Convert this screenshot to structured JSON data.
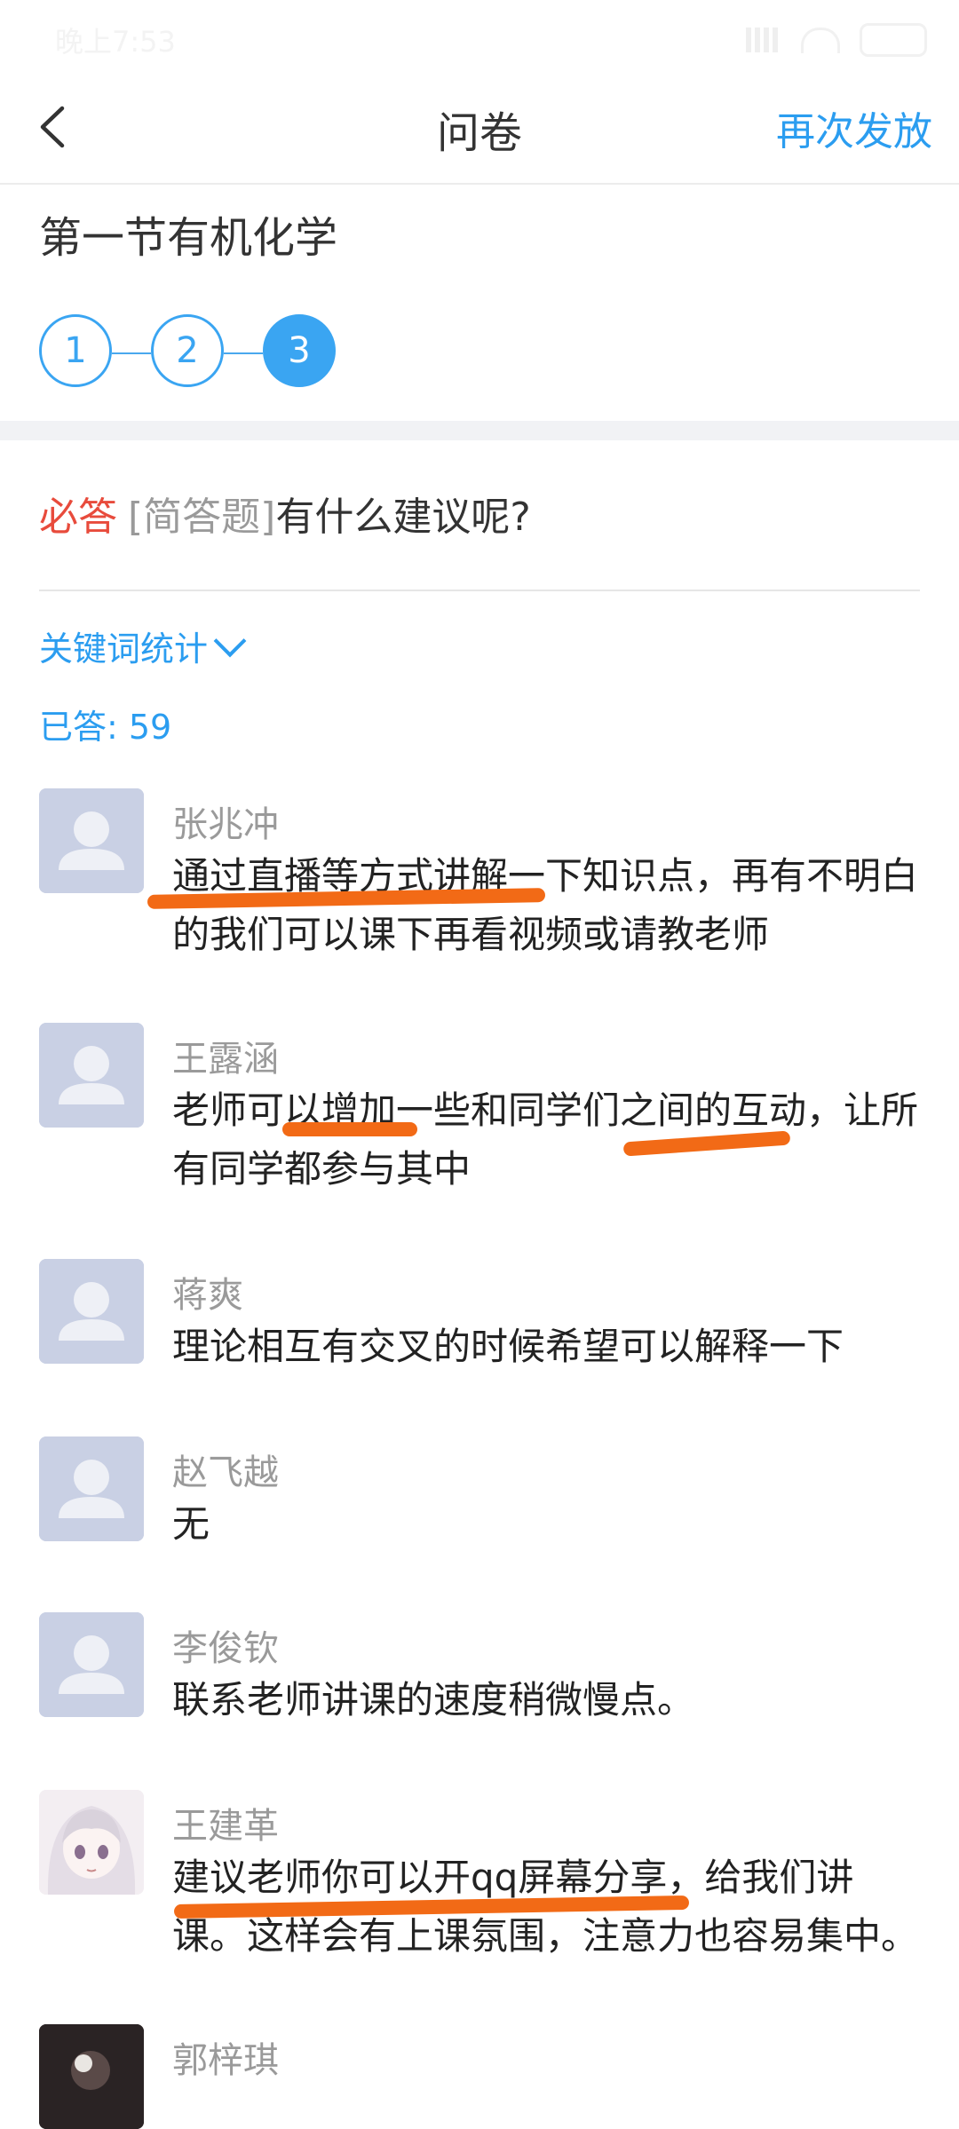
{
  "status_bar": {
    "time": "晚上7:53"
  },
  "nav": {
    "back_icon": "chevron-left-icon",
    "title": "问卷",
    "action": "再次发放"
  },
  "survey": {
    "title": "第一节有机化学",
    "steps": [
      "1",
      "2",
      "3"
    ],
    "active_step": 3
  },
  "question": {
    "required_label": "必答",
    "type_label": "[简答题]",
    "text": "有什么建议呢?",
    "keyword_stats": "关键词统计",
    "answered": "已答: 59"
  },
  "responses": [
    {
      "name": "张兆冲",
      "text": "通过直播等方式讲解一下知识点，再有不明白的我们可以课下再看视频或请教老师",
      "avatar": "default-avatar-icon"
    },
    {
      "name": "王露涵",
      "text": "老师可以增加一些和同学们之间的互动，让所有同学都参与其中",
      "avatar": "default-avatar-icon"
    },
    {
      "name": "蒋爽",
      "text": "理论相互有交叉的时候希望可以解释一下",
      "avatar": "default-avatar-icon"
    },
    {
      "name": "赵飞越",
      "text": "无",
      "avatar": "default-avatar-icon"
    },
    {
      "name": "李俊钦",
      "text": "联系老师讲课的速度稍微慢点。",
      "avatar": "default-avatar-icon"
    },
    {
      "name": "王建革",
      "text": "建议老师你可以开qq屏幕分享，给我们讲课。这样会有上课氛围，注意力也容易集中。",
      "avatar": "anime-girl-avatar"
    },
    {
      "name": "郭梓琪",
      "text": "",
      "avatar": "photo-avatar"
    }
  ],
  "colors": {
    "accent": "#2b9df0",
    "required": "#e84b3c",
    "highlight_mark": "#f26a16"
  }
}
